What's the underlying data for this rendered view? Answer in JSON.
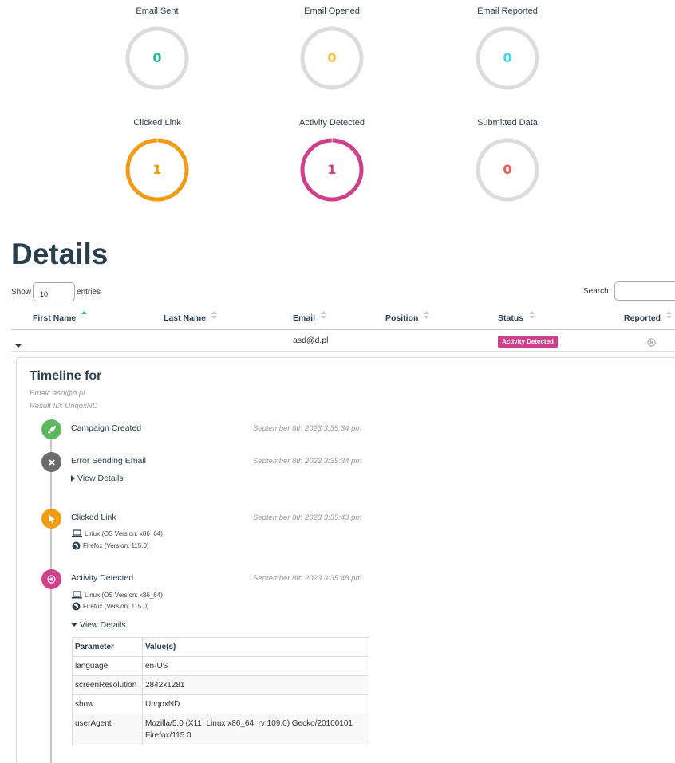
{
  "stats": [
    {
      "label": "Email Sent",
      "value": "0",
      "fraction": 0,
      "color": "#1abc9c"
    },
    {
      "label": "Email Opened",
      "value": "0",
      "fraction": 0,
      "color": "#f9bf3b"
    },
    {
      "label": "Email Reported",
      "value": "0",
      "fraction": 0,
      "color": "#45d6ef"
    },
    {
      "label": "Clicked Link",
      "value": "1",
      "fraction": 1,
      "color": "#f39c12"
    },
    {
      "label": "Activity Detected",
      "value": "1",
      "fraction": 1,
      "color": "#d13f8b"
    },
    {
      "label": "Submitted Data",
      "value": "0",
      "fraction": 0,
      "color": "#f05b4f"
    }
  ],
  "details": {
    "title": "Details",
    "show_label": "Show",
    "length_value": "10",
    "entries_label": "entries",
    "search_label": "Search:",
    "columns": [
      "First Name",
      "Last Name",
      "Email",
      "Position",
      "Status",
      "Reported"
    ],
    "row": {
      "first_name": "",
      "last_name": "",
      "email": "asd@d.pl",
      "position": "",
      "status": "Activity Detected",
      "status_color": "#d13f8b"
    }
  },
  "timeline": {
    "title": "Timeline for",
    "email_line": "Email: asd@d.pl",
    "result_line": "Result ID: UnqoxND",
    "events": [
      {
        "name": "Campaign Created",
        "date": "September 8th 2023 3:35:34 pm",
        "color": "#5cb85c",
        "icon": "rocket-icon"
      },
      {
        "name": "Error Sending Email",
        "date": "September 8th 2023 3:35:34 pm",
        "color": "#6b6b6b",
        "icon": "close-icon",
        "toggle": "View Details"
      },
      {
        "name": "Clicked Link",
        "date": "September 8th 2023 3:35:43 pm",
        "color": "#f39c12",
        "icon": "cursor-icon",
        "os": "Linux (OS Version: x86_64)",
        "browser": "Firefox (Version: 115.0)"
      },
      {
        "name": "Activity Detected",
        "date": "September 8th 2023 3:35:48 pm",
        "color": "#d13f8b",
        "icon": "target-icon",
        "os": "Linux (OS Version: x86_64)",
        "browser": "Firefox (Version: 115.0)",
        "toggle": "View Details"
      }
    ],
    "details_table": {
      "headers": [
        "Parameter",
        "Value(s)"
      ],
      "rows": [
        [
          "language",
          "en-US"
        ],
        [
          "screenResolution",
          "2842x1281"
        ],
        [
          "show",
          "UnqoxND"
        ],
        [
          "userAgent",
          "Mozilla/5.0 (X11; Linux x86_64; rv:109.0) Gecko/20100101 Firefox/115.0"
        ]
      ]
    }
  }
}
